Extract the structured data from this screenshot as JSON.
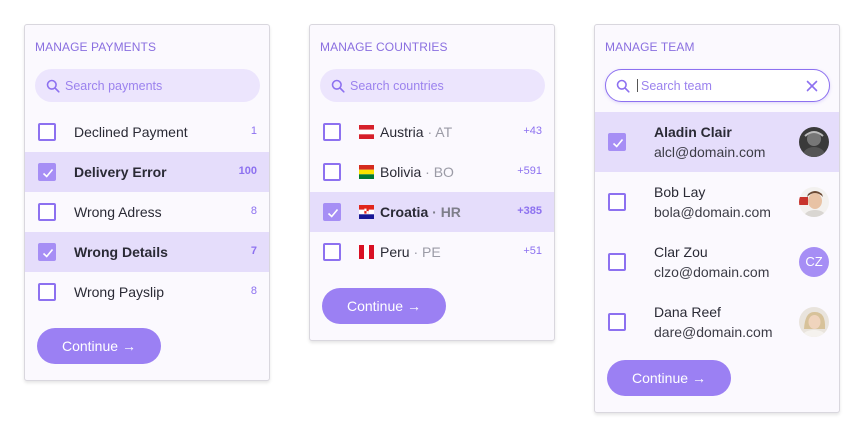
{
  "colors": {
    "accent": "#9b80f3",
    "selected_row": "#e5ddfb",
    "title": "#8a6fe0",
    "card_bg": "#fbf9fe"
  },
  "payments": {
    "title": "MANAGE PAYMENTS",
    "search_placeholder": "Search payments",
    "items": [
      {
        "label": "Declined Payment",
        "count": "1",
        "checked": false
      },
      {
        "label": "Delivery Error",
        "count": "100",
        "checked": true
      },
      {
        "label": "Wrong Adress",
        "count": "8",
        "checked": false
      },
      {
        "label": "Wrong Details",
        "count": "7",
        "checked": true
      },
      {
        "label": "Wrong Payslip",
        "count": "8",
        "checked": false
      }
    ],
    "continue_label": "Continue",
    "continue_arrow": "→"
  },
  "countries": {
    "title": "MANAGE COUNTRIES",
    "search_placeholder": "Search countries",
    "items": [
      {
        "name": "Austria",
        "code": "AT",
        "count": "+43",
        "checked": false,
        "flag_icon": "austria-flag-icon"
      },
      {
        "name": "Bolivia",
        "code": "BO",
        "count": "+591",
        "checked": false,
        "flag_icon": "bolivia-flag-icon"
      },
      {
        "name": "Croatia",
        "code": "HR",
        "count": "+385",
        "checked": true,
        "flag_icon": "croatia-flag-icon"
      },
      {
        "name": "Peru",
        "code": "PE",
        "count": "+51",
        "checked": false,
        "flag_icon": "peru-flag-icon"
      }
    ],
    "separator": "·",
    "continue_label": "Continue",
    "continue_arrow": "→"
  },
  "team": {
    "title": "MANAGE TEAM",
    "search_placeholder": "Search team",
    "members": [
      {
        "name": "Aladin Clair",
        "email": "alcl@domain.com",
        "checked": true
      },
      {
        "name": "Bob Lay",
        "email": "bola@domain.com",
        "checked": false
      },
      {
        "name": "Clar Zou",
        "email": "clzo@domain.com",
        "checked": false,
        "initials": "CZ"
      },
      {
        "name": "Dana Reef",
        "email": "dare@domain.com",
        "checked": false
      }
    ],
    "continue_label": "Continue",
    "continue_arrow": "→"
  }
}
